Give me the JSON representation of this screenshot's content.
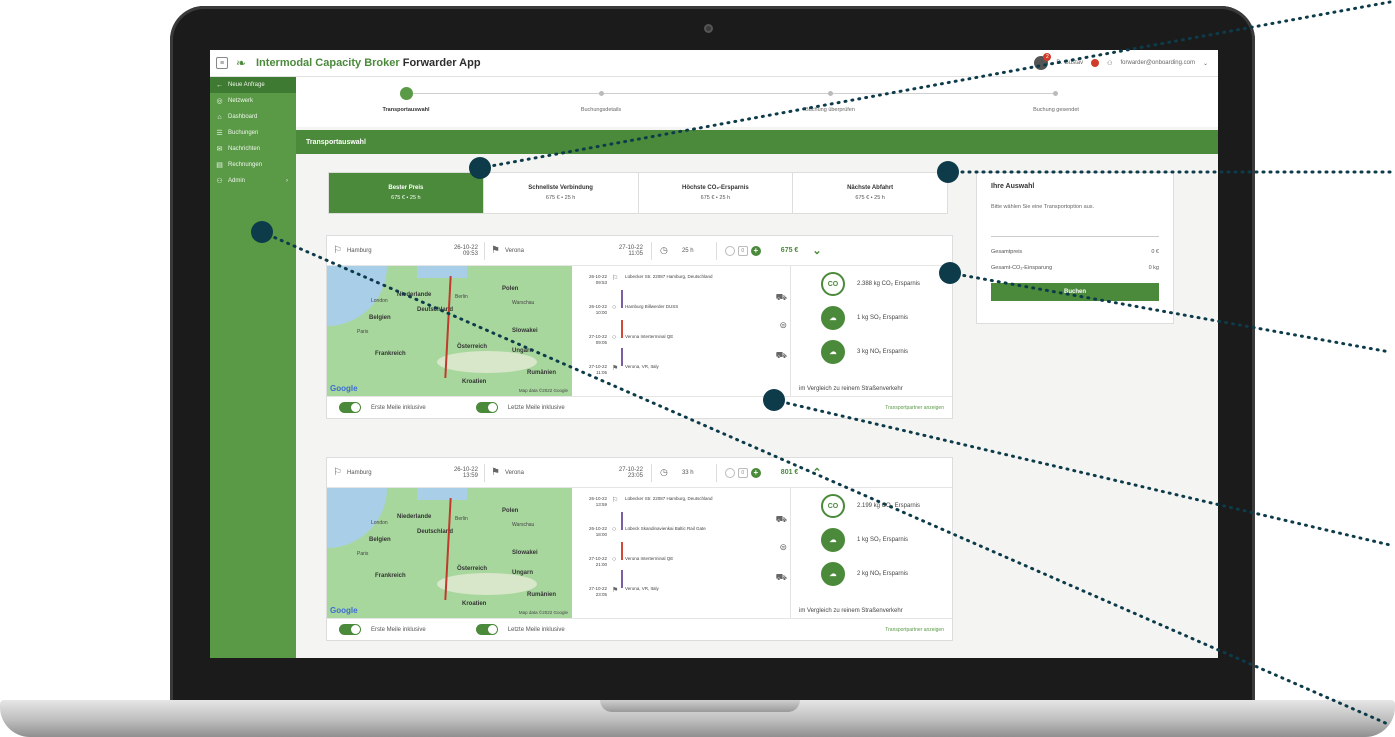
{
  "app": {
    "title_green": "Intermodal Capacity Broker",
    "title_dark": "Forwarder App",
    "user_name": "D. Gustav",
    "user_email": "forwarder@onboarding.com"
  },
  "sidebar": {
    "items": [
      {
        "label": "Neue Anfrage",
        "icon": "arrow-left-icon"
      },
      {
        "label": "Netzwerk",
        "icon": "globe-icon"
      },
      {
        "label": "Dashboard",
        "icon": "home-icon"
      },
      {
        "label": "Buchungen",
        "icon": "list-icon"
      },
      {
        "label": "Nachrichten",
        "icon": "mail-icon"
      },
      {
        "label": "Rechnungen",
        "icon": "invoice-icon"
      },
      {
        "label": "Admin",
        "icon": "people-icon"
      }
    ]
  },
  "stepper": {
    "steps": [
      "Transportauswahl",
      "Buchungsdetails",
      "Buchung überprüfen",
      "Buchung gesendet"
    ]
  },
  "section": {
    "title": "Transportauswahl"
  },
  "tabs": [
    {
      "title": "Bester Preis",
      "sub": "675 € • 25 h"
    },
    {
      "title": "Schnellste Verbindung",
      "sub": "675 € • 25 h"
    },
    {
      "title": "Höchste CO₂-Ersparnis",
      "sub": "675 € • 25 h"
    },
    {
      "title": "Nächste Abfahrt",
      "sub": "675 € • 25 h"
    }
  ],
  "cards": [
    {
      "from": "Hamburg",
      "dep": "26-10-22 09:53",
      "to": "Verona",
      "arr": "27-10-22 11:05",
      "duration": "25 h",
      "count": "0",
      "price": "675 €",
      "timeline": [
        {
          "date": "26-10-22 09:53",
          "text": "Lübecker Str. 22087 Hamburg, Deutschland"
        },
        {
          "date": "26-10-22 10:00",
          "text": "Hamburg Billwerder DUSS"
        },
        {
          "date": "27-10-22 09:05",
          "text": "Verona Interterminal QE"
        },
        {
          "date": "27-10-22 11:05",
          "text": "Verona, VR, Italy"
        }
      ],
      "emissions": [
        "2.388 kg CO₂ Ersparnis",
        "1 kg SO₂ Ersparnis",
        "3 kg NOₓ Ersparnis"
      ],
      "note": "im Vergleich zu reinem Straßenverkehr",
      "toggles": [
        "Erste Meile inklusive",
        "Letzte Meile inklusive"
      ],
      "link": "Transportpartner anzeigen"
    },
    {
      "from": "Hamburg",
      "dep": "26-10-22 13:59",
      "to": "Verona",
      "arr": "27-10-22 23:05",
      "duration": "33 h",
      "count": "0",
      "price": "801 €",
      "timeline": [
        {
          "date": "26-10-22 13:59",
          "text": "Lübecker Str. 22087 Hamburg, Deutschland"
        },
        {
          "date": "26-10-22 18:00",
          "text": "Lübeck Skandinavienkai Baltic Rail Gate"
        },
        {
          "date": "27-10-22 21:00",
          "text": "Verona Interterminal QE"
        },
        {
          "date": "27-10-22 23:05",
          "text": "Verona, VR, Italy"
        }
      ],
      "emissions": [
        "2.199 kg CO₂ Ersparnis",
        "1 kg SO₂ Ersparnis",
        "2 kg NOₓ Ersparnis"
      ],
      "note": "im Vergleich zu reinem Straßenverkehr",
      "toggles": [
        "Erste Meile inklusive",
        "Letzte Meile inklusive"
      ],
      "link": "Transportpartner anzeigen"
    }
  ],
  "map": {
    "labels": [
      "Niederlande",
      "Berlin",
      "Deutschland",
      "Polen",
      "London",
      "Warschau",
      "Belgien",
      "Paris",
      "Slowakei",
      "Österreich",
      "Ungarn",
      "Frankreich",
      "Rumänien",
      "Kroatien"
    ],
    "google": "Google",
    "mapdata": "Map data ©2022 Google"
  },
  "selection": {
    "title": "Ihre Auswahl",
    "hint": "Bitte wählen Sie eine Transportoption aus.",
    "total_label": "Gesamtpreis",
    "total_value": "0 €",
    "co2_label": "Gesamt-CO₂-Einsparung",
    "co2_value": "0 kg",
    "button": "Buchen"
  },
  "colors": {
    "brand": "#4a8a3a",
    "annotation": "#0d3b4a"
  }
}
